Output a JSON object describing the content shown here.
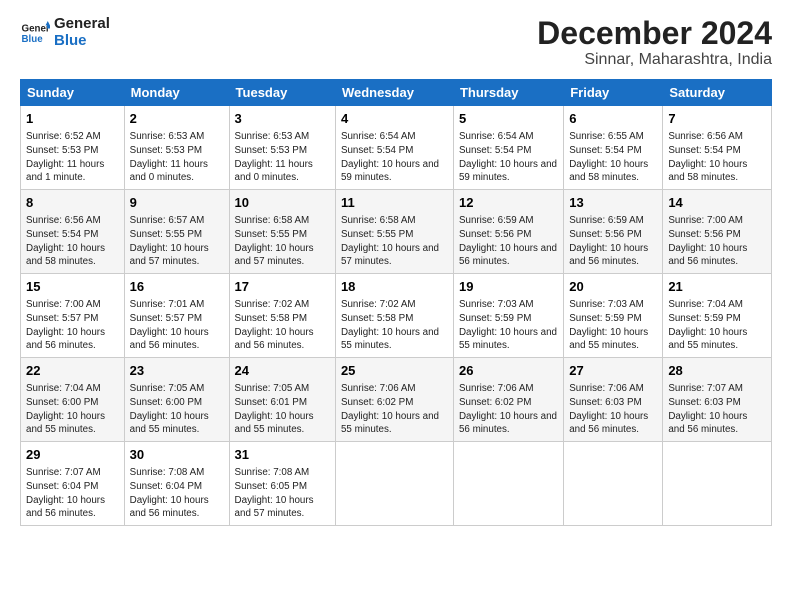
{
  "logo": {
    "line1": "General",
    "line2": "Blue"
  },
  "title": "December 2024",
  "subtitle": "Sinnar, Maharashtra, India",
  "days_of_week": [
    "Sunday",
    "Monday",
    "Tuesday",
    "Wednesday",
    "Thursday",
    "Friday",
    "Saturday"
  ],
  "weeks": [
    [
      {
        "day": "1",
        "info": "Sunrise: 6:52 AM\nSunset: 5:53 PM\nDaylight: 11 hours and 1 minute."
      },
      {
        "day": "2",
        "info": "Sunrise: 6:53 AM\nSunset: 5:53 PM\nDaylight: 11 hours and 0 minutes."
      },
      {
        "day": "3",
        "info": "Sunrise: 6:53 AM\nSunset: 5:53 PM\nDaylight: 11 hours and 0 minutes."
      },
      {
        "day": "4",
        "info": "Sunrise: 6:54 AM\nSunset: 5:54 PM\nDaylight: 10 hours and 59 minutes."
      },
      {
        "day": "5",
        "info": "Sunrise: 6:54 AM\nSunset: 5:54 PM\nDaylight: 10 hours and 59 minutes."
      },
      {
        "day": "6",
        "info": "Sunrise: 6:55 AM\nSunset: 5:54 PM\nDaylight: 10 hours and 58 minutes."
      },
      {
        "day": "7",
        "info": "Sunrise: 6:56 AM\nSunset: 5:54 PM\nDaylight: 10 hours and 58 minutes."
      }
    ],
    [
      {
        "day": "8",
        "info": "Sunrise: 6:56 AM\nSunset: 5:54 PM\nDaylight: 10 hours and 58 minutes."
      },
      {
        "day": "9",
        "info": "Sunrise: 6:57 AM\nSunset: 5:55 PM\nDaylight: 10 hours and 57 minutes."
      },
      {
        "day": "10",
        "info": "Sunrise: 6:58 AM\nSunset: 5:55 PM\nDaylight: 10 hours and 57 minutes."
      },
      {
        "day": "11",
        "info": "Sunrise: 6:58 AM\nSunset: 5:55 PM\nDaylight: 10 hours and 57 minutes."
      },
      {
        "day": "12",
        "info": "Sunrise: 6:59 AM\nSunset: 5:56 PM\nDaylight: 10 hours and 56 minutes."
      },
      {
        "day": "13",
        "info": "Sunrise: 6:59 AM\nSunset: 5:56 PM\nDaylight: 10 hours and 56 minutes."
      },
      {
        "day": "14",
        "info": "Sunrise: 7:00 AM\nSunset: 5:56 PM\nDaylight: 10 hours and 56 minutes."
      }
    ],
    [
      {
        "day": "15",
        "info": "Sunrise: 7:00 AM\nSunset: 5:57 PM\nDaylight: 10 hours and 56 minutes."
      },
      {
        "day": "16",
        "info": "Sunrise: 7:01 AM\nSunset: 5:57 PM\nDaylight: 10 hours and 56 minutes."
      },
      {
        "day": "17",
        "info": "Sunrise: 7:02 AM\nSunset: 5:58 PM\nDaylight: 10 hours and 56 minutes."
      },
      {
        "day": "18",
        "info": "Sunrise: 7:02 AM\nSunset: 5:58 PM\nDaylight: 10 hours and 55 minutes."
      },
      {
        "day": "19",
        "info": "Sunrise: 7:03 AM\nSunset: 5:59 PM\nDaylight: 10 hours and 55 minutes."
      },
      {
        "day": "20",
        "info": "Sunrise: 7:03 AM\nSunset: 5:59 PM\nDaylight: 10 hours and 55 minutes."
      },
      {
        "day": "21",
        "info": "Sunrise: 7:04 AM\nSunset: 5:59 PM\nDaylight: 10 hours and 55 minutes."
      }
    ],
    [
      {
        "day": "22",
        "info": "Sunrise: 7:04 AM\nSunset: 6:00 PM\nDaylight: 10 hours and 55 minutes."
      },
      {
        "day": "23",
        "info": "Sunrise: 7:05 AM\nSunset: 6:00 PM\nDaylight: 10 hours and 55 minutes."
      },
      {
        "day": "24",
        "info": "Sunrise: 7:05 AM\nSunset: 6:01 PM\nDaylight: 10 hours and 55 minutes."
      },
      {
        "day": "25",
        "info": "Sunrise: 7:06 AM\nSunset: 6:02 PM\nDaylight: 10 hours and 55 minutes."
      },
      {
        "day": "26",
        "info": "Sunrise: 7:06 AM\nSunset: 6:02 PM\nDaylight: 10 hours and 56 minutes."
      },
      {
        "day": "27",
        "info": "Sunrise: 7:06 AM\nSunset: 6:03 PM\nDaylight: 10 hours and 56 minutes."
      },
      {
        "day": "28",
        "info": "Sunrise: 7:07 AM\nSunset: 6:03 PM\nDaylight: 10 hours and 56 minutes."
      }
    ],
    [
      {
        "day": "29",
        "info": "Sunrise: 7:07 AM\nSunset: 6:04 PM\nDaylight: 10 hours and 56 minutes."
      },
      {
        "day": "30",
        "info": "Sunrise: 7:08 AM\nSunset: 6:04 PM\nDaylight: 10 hours and 56 minutes."
      },
      {
        "day": "31",
        "info": "Sunrise: 7:08 AM\nSunset: 6:05 PM\nDaylight: 10 hours and 57 minutes."
      },
      {
        "day": "",
        "info": ""
      },
      {
        "day": "",
        "info": ""
      },
      {
        "day": "",
        "info": ""
      },
      {
        "day": "",
        "info": ""
      }
    ]
  ]
}
